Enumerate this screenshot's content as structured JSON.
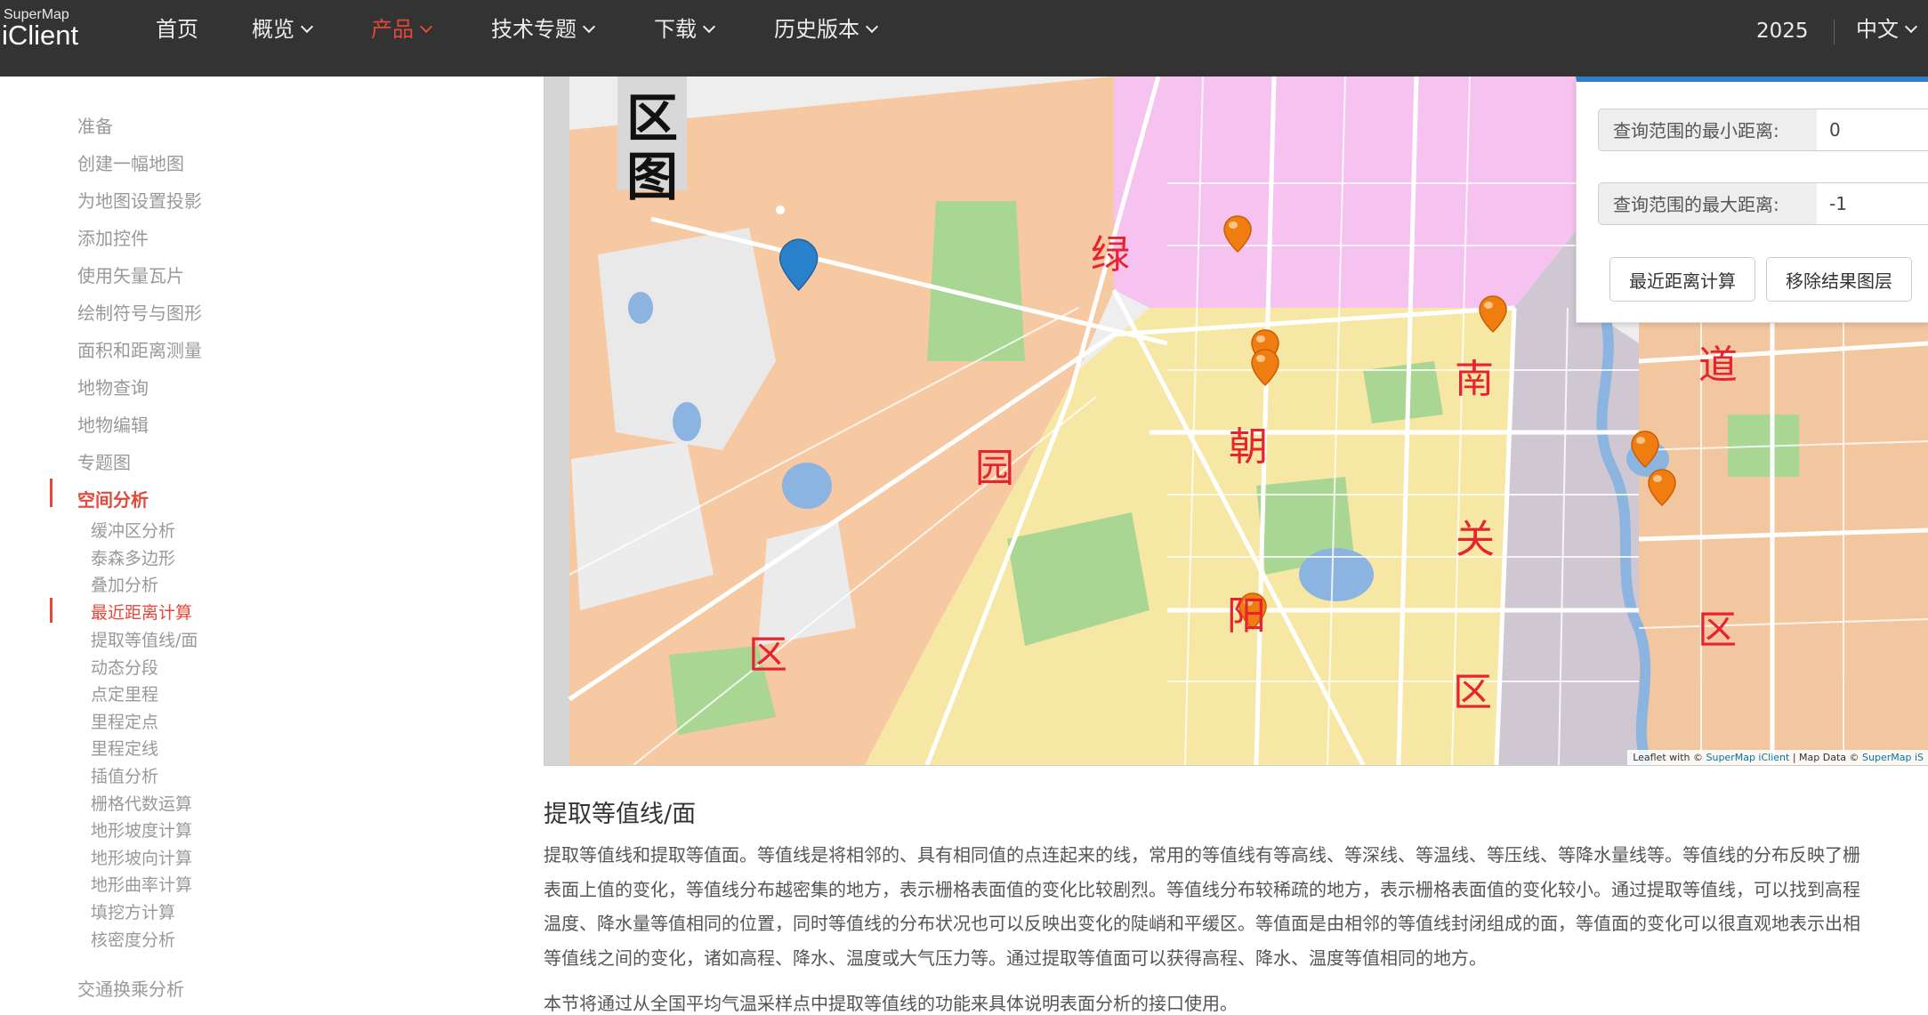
{
  "brand": {
    "small": "SuperMap",
    "big": "iClient"
  },
  "nav": {
    "items": [
      {
        "label": "首页",
        "dropdown": false
      },
      {
        "label": "概览",
        "dropdown": true
      },
      {
        "label": "产品",
        "dropdown": true,
        "active": true
      },
      {
        "label": "技术专题",
        "dropdown": true
      },
      {
        "label": "下载",
        "dropdown": true
      },
      {
        "label": "历史版本",
        "dropdown": true
      }
    ],
    "year": "2025",
    "language": "中文"
  },
  "sidebar": {
    "items": [
      "准备",
      "创建一幅地图",
      "为地图设置投影",
      "添加控件",
      "使用矢量瓦片",
      "绘制符号与图形",
      "面积和距离测量",
      "地物查询",
      "地物编辑",
      "专题图",
      "空间分析"
    ],
    "active_item": "空间分析",
    "subitems": [
      "缓冲区分析",
      "泰森多边形",
      "叠加分析",
      "最近距离计算",
      "提取等值线/面",
      "动态分段",
      "点定里程",
      "里程定点",
      "里程定线",
      "插值分析",
      "栅格代数运算",
      "地形坡度计算",
      "地形坡向计算",
      "地形曲率计算",
      "填挖方计算",
      "核密度分析"
    ],
    "active_subitem": "最近距离计算",
    "after_item": "交通换乘分析"
  },
  "map": {
    "district_labels": [
      "绿",
      "园",
      "区",
      "朝",
      "阳",
      "南",
      "关",
      "区",
      "道",
      "区"
    ],
    "legend_chars": [
      "区",
      "图"
    ],
    "attribution": {
      "prefix": "Leaflet with ©",
      "link1": "SuperMap iClient",
      "middle": "| Map Data ©",
      "link2": "SuperMap iS"
    },
    "colors": {
      "orange": "#f7c9a2",
      "yellow": "#f6e8a4",
      "pink": "#f6c3f0",
      "gray": "#cfc8d3",
      "green": "#a9d693",
      "water": "#8cb4e0",
      "road": "#ffffff",
      "marker_orange": "#f07d10",
      "marker_blue": "#2a81cb"
    }
  },
  "panel": {
    "min_label": "查询范围的最小距离:",
    "min_value": "0",
    "max_label": "查询范围的最大距离:",
    "max_value": "-1",
    "calc_button": "最近距离计算",
    "remove_button": "移除结果图层"
  },
  "content": {
    "title": "提取等值线/面",
    "paragraph_lines": [
      "提取等值线和提取等值面。等值线是将相邻的、具有相同值的点连起来的线，常用的等值线有等高线、等深线、等温线、等压线、等降水量线等。等值线的分布反映了栅",
      "表面上值的变化，等值线分布越密集的地方，表示栅格表面值的变化比较剧烈。等值线分布较稀疏的地方，表示栅格表面值的变化较小。通过提取等值线，可以找到高程",
      "温度、降水量等值相同的位置，同时等值线的分布状况也可以反映出变化的陡峭和平缓区。等值面是由相邻的等值线封闭组成的面，等值面的变化可以很直观地表示出相",
      "等值线之间的变化，诸如高程、降水、温度或大气压力等。通过提取等值面可以获得高程、降水、温度等值相同的地方。"
    ],
    "note": "本节将通过从全国平均气温采样点中提取等值线的功能来具体说明表面分析的接口使用。"
  }
}
